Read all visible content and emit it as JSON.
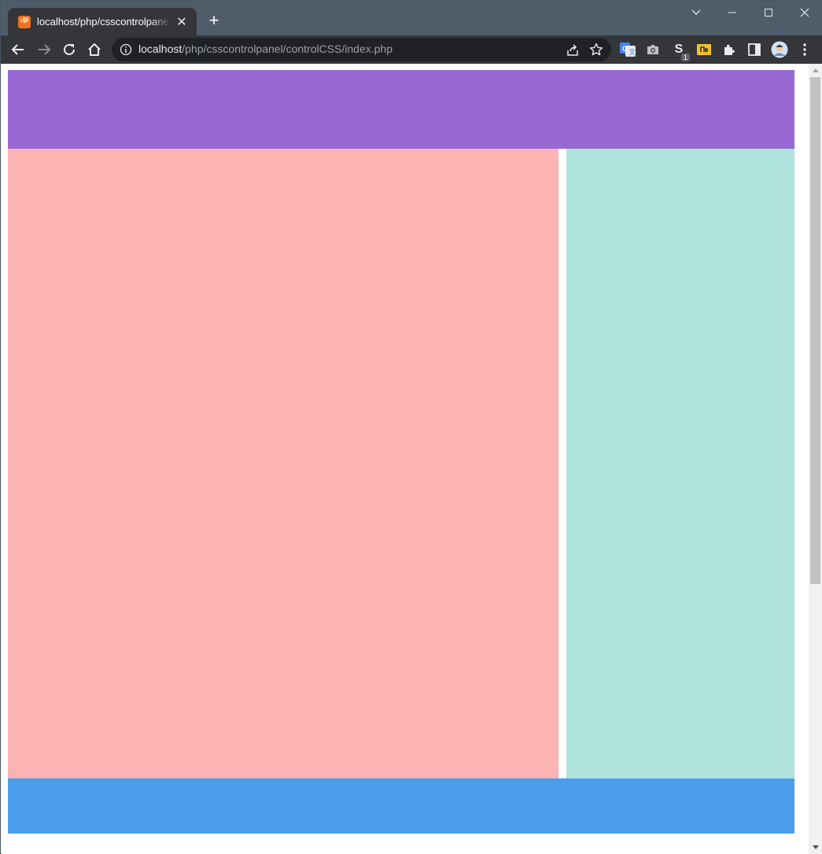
{
  "browser": {
    "tab": {
      "title": "localhost/php/csscontrolpanel/controlCSS/index.php",
      "favicon_text": "ঞ",
      "close_glyph": "✕"
    },
    "new_tab_glyph": "+",
    "omnibox": {
      "host": "localhost",
      "path": "/php/csscontrolpanel/controlCSS/index.php"
    },
    "extension_badge": "1",
    "extension_letter": "S"
  },
  "page": {
    "colors": {
      "header": "#9869d3",
      "main": "#fbb3b3",
      "aside": "#b0e3dd",
      "footer": "#4a9eeb"
    }
  },
  "icons": {
    "minimize": "minimize-icon",
    "maximize": "maximize-icon",
    "close": "close-icon",
    "back": "back-arrow-icon",
    "forward": "forward-arrow-icon",
    "reload": "reload-icon",
    "home": "home-icon",
    "info": "info-icon",
    "share": "share-icon",
    "bookmark": "star-icon",
    "translate": "google-translate-icon",
    "camera": "camera-icon",
    "puzzle": "extensions-puzzle-icon",
    "sidepanel": "side-panel-icon",
    "menu": "kebab-menu-icon"
  }
}
